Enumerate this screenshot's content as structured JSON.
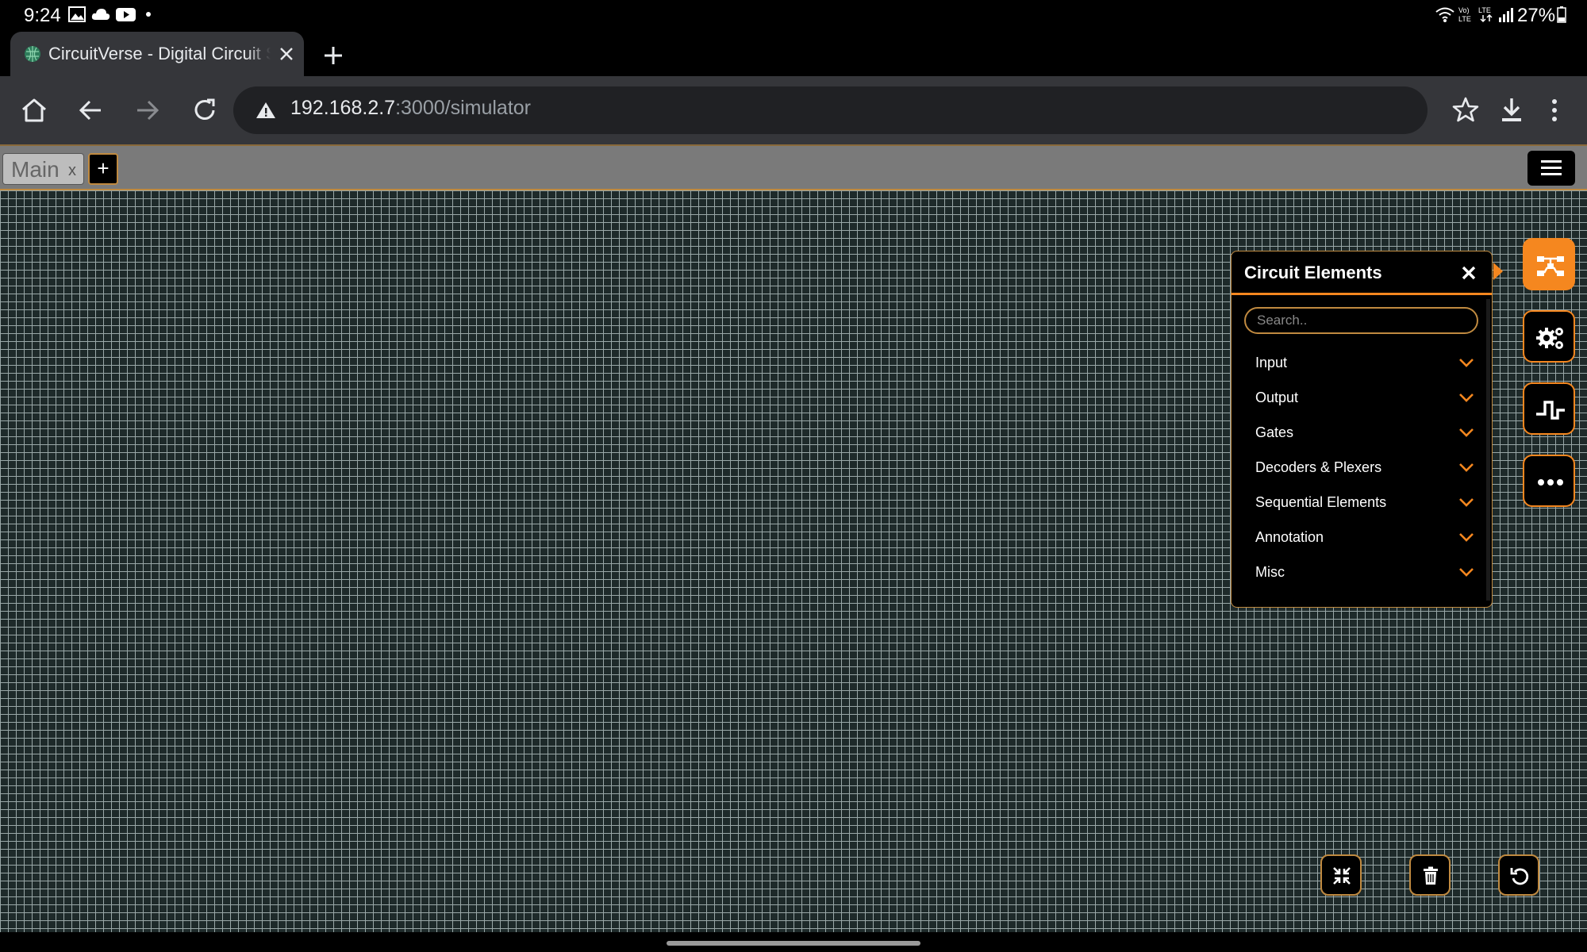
{
  "status_bar": {
    "time": "9:24",
    "battery": "27%",
    "left_icons": [
      "image-icon",
      "cloud-icon",
      "youtube-icon",
      "dot-icon"
    ],
    "right_icons": [
      "wifi-icon",
      "volte-icon",
      "lte-icon",
      "signal-icon",
      "battery-icon"
    ]
  },
  "browser": {
    "tab_title": "CircuitVerse - Digital Circuit Simulator",
    "url_host": "192.168.2.7",
    "url_rest": ":3000/simulator"
  },
  "simulator": {
    "circuit_tab_label": "Main",
    "circuit_tab_close": "x",
    "add_circuit_label": "+",
    "panel": {
      "title": "Circuit Elements",
      "search_placeholder": "Search..",
      "categories": [
        {
          "label": "Input"
        },
        {
          "label": "Output"
        },
        {
          "label": "Gates"
        },
        {
          "label": "Decoders & Plexers"
        },
        {
          "label": "Sequential Elements"
        },
        {
          "label": "Annotation"
        },
        {
          "label": "Misc"
        }
      ]
    },
    "side_tools": [
      "circuit-elements-icon",
      "settings-gears-icon",
      "timing-diagram-icon",
      "more-icon"
    ],
    "canvas_controls": [
      "fit-screen-icon",
      "trash-icon",
      "undo-icon"
    ]
  },
  "colors": {
    "accent": "#f5871f",
    "panel_border": "#c08a40",
    "canvas_bg": "#1e2a2a",
    "grid_line": "#9aa8a8",
    "toolbar": "#35363a"
  }
}
